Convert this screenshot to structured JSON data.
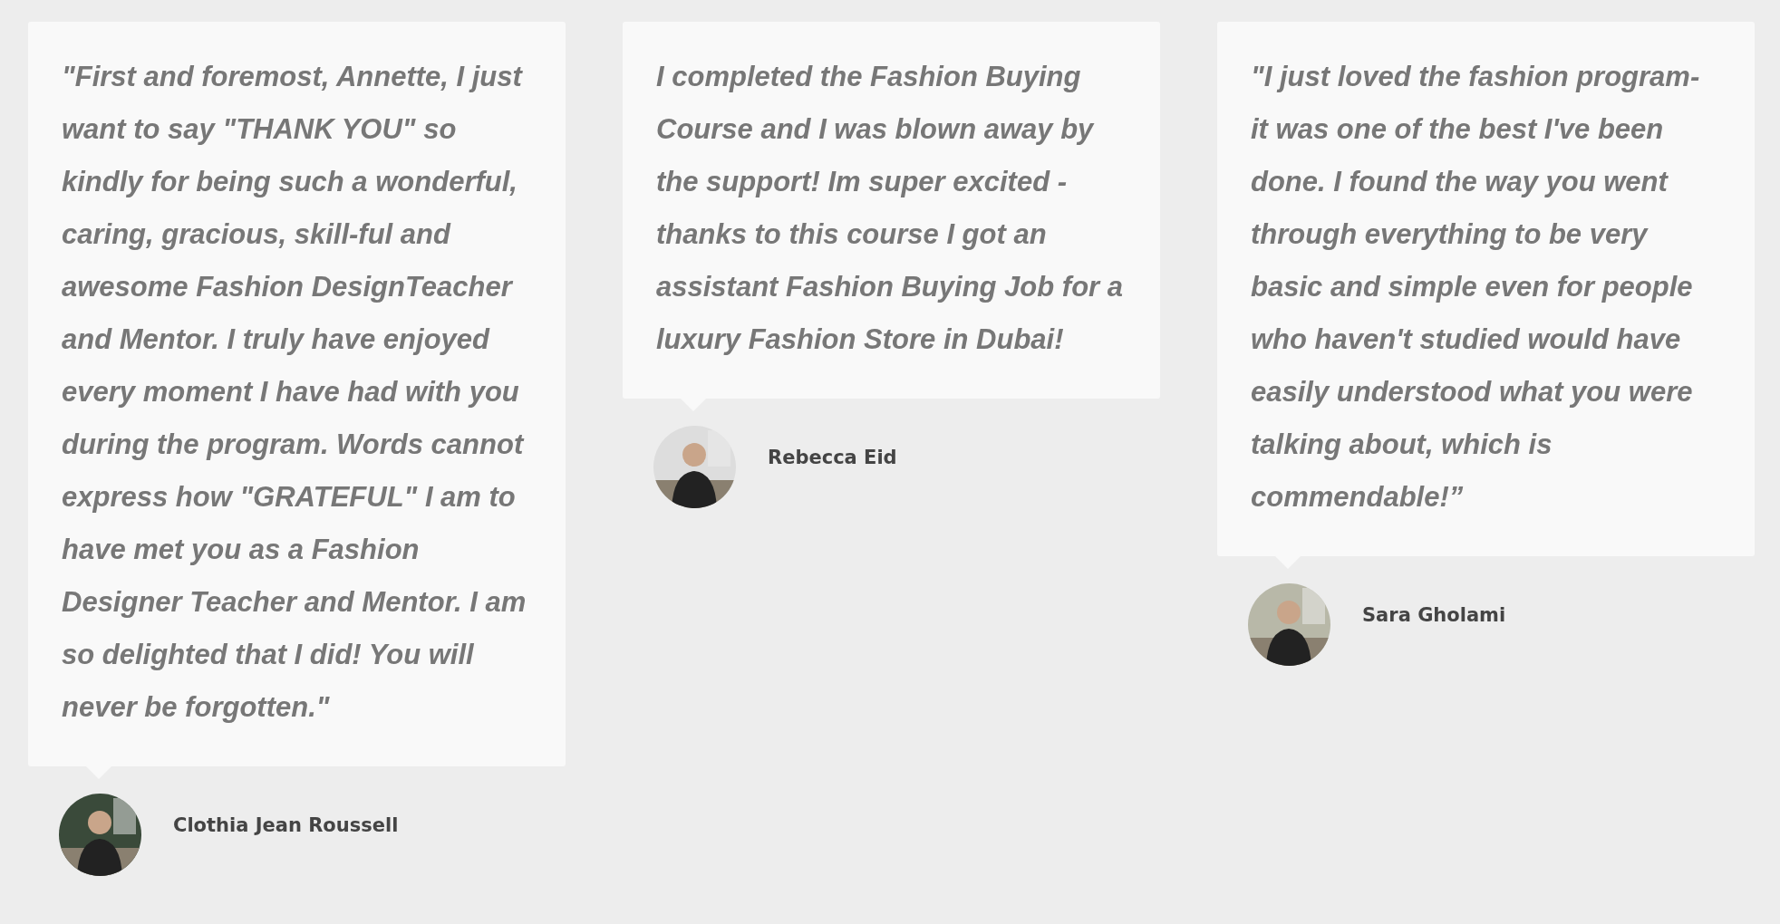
{
  "testimonials": [
    {
      "quote": "\"First and foremost, Annette, I just want to say \"THANK YOU\" so kindly for being such a wonderful, caring, gracious, skill-ful and awesome Fashion DesignTeacher and Mentor. I truly have enjoyed every moment I have had with you during the program. Words cannot express how \"GRATEFUL\" I am to have met you as a Fashion Designer Teacher and Mentor. I am so delighted that I did! You will never be forgotten.\"",
      "name": "Clothia Jean Roussell"
    },
    {
      "quote": "I completed the Fashion Buying Course and I was blown away by the support! Im super excited - thanks to this course I got an assistant Fashion Buying Job for a luxury Fashion Store in Dubai!",
      "name": "Rebecca Eid"
    },
    {
      "quote": "\"I just loved the fashion program- it was one of the best I've been done. I found the way you went through everything to be very basic and simple even for people who haven't studied would have easily understood what you were talking about, which is commendable!”",
      "name": "Sara Gholami"
    }
  ]
}
